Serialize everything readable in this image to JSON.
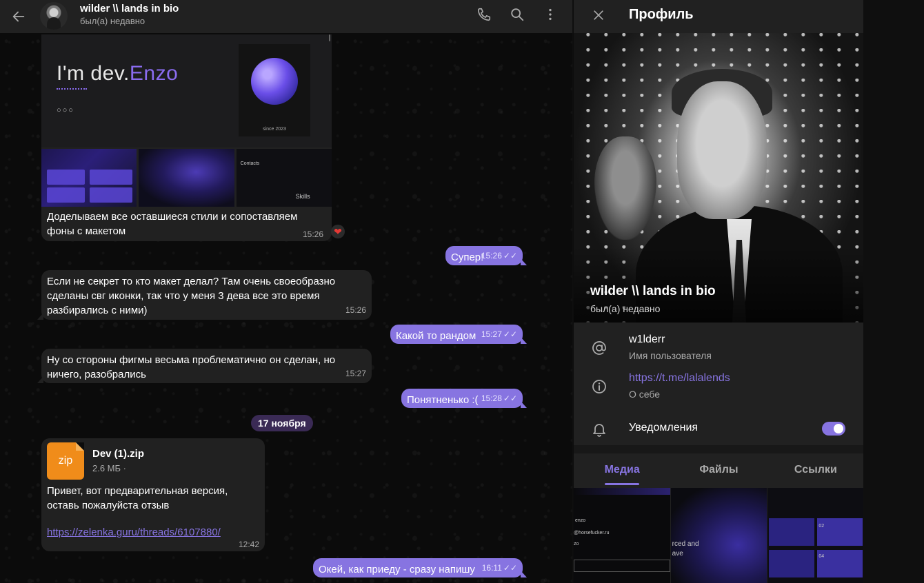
{
  "chat": {
    "title": "wilder \\\\ lands in bio",
    "status": "был(а) недавно",
    "header_icons": [
      "phone-icon",
      "search-icon",
      "more-vertical-icon"
    ],
    "preview_card": {
      "heading_prefix": "I'm dev.",
      "heading_accent": "Enzo",
      "ornament": "○○○",
      "since": "since 2023",
      "thumb_labels": [
        "Contacts",
        "Skills"
      ]
    },
    "messages": [
      {
        "id": "m1",
        "side": "in",
        "text": "Доделываем все оставшиеся стили и сопоставляем фоны с макетом",
        "time": "15:26",
        "reaction": "❤"
      },
      {
        "id": "m2",
        "side": "out",
        "text": "Супер!",
        "time": "15:26"
      },
      {
        "id": "m3",
        "side": "in",
        "text": "Если не секрет то кто макет делал? Там очень своеобразно сделаны свг иконки, так что у меня 3 дева все это время разбирались с ними)",
        "time": "15:26"
      },
      {
        "id": "m4",
        "side": "out",
        "text": "Какой то рандом",
        "time": "15:27"
      },
      {
        "id": "m5",
        "side": "in",
        "text": "Ну со стороны фигмы весьма проблематично он сделан, но ничего, разобрались",
        "time": "15:27"
      },
      {
        "id": "m6",
        "side": "out",
        "text": "Понятненько :(",
        "time": "15:28"
      },
      {
        "id": "m8",
        "side": "out",
        "text": "Окей, как приеду - сразу напишу",
        "time": "16:11"
      }
    ],
    "date_separator": "17 ноября",
    "file_message": {
      "icon_label": "zip",
      "file_name": "Dev (1).zip",
      "file_size": "2.6 МБ ·",
      "text": "Привет, вот предварительная версия, оставь пожалуйста отзыв",
      "link": "https://zelenka.guru/threads/6107880/",
      "time": "12:42"
    }
  },
  "profile": {
    "title": "Профиль",
    "name": "wilder \\\\ lands in bio",
    "status": "был(а) недавно",
    "username": "w1lderr",
    "username_label": "Имя пользователя",
    "bio": "https://t.me/lalalends",
    "bio_label": "О себе",
    "notifications_label": "Уведомления",
    "notifications_on": true,
    "tabs": [
      "Медиа",
      "Файлы",
      "Ссылки"
    ],
    "active_tab": "Медиа",
    "grid_texts": {
      "g1": [
        "enzo",
        "@horsefucker.ru",
        "zo"
      ],
      "g2": [
        "rced and",
        "ave"
      ],
      "g3": [
        "02",
        "04"
      ]
    },
    "accent_color": "#8774e1"
  }
}
